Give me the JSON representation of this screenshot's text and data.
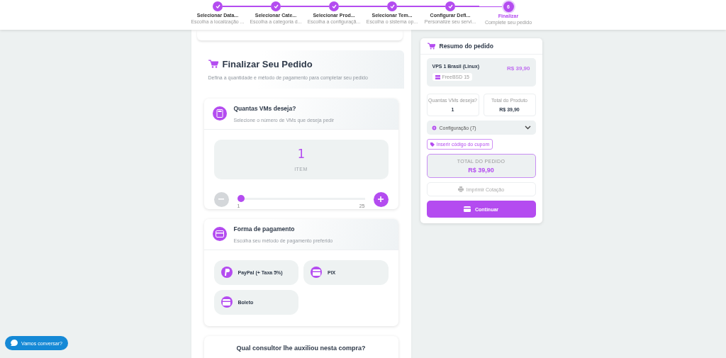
{
  "stepper": [
    {
      "title": "Selecionar Data...",
      "subtitle": "Escolha a localização ...",
      "done": true,
      "selected": false
    },
    {
      "title": "Selecionar Cate...",
      "subtitle": "Escolha a categoria d...",
      "done": true,
      "selected": false
    },
    {
      "title": "Selecionar Prod...",
      "subtitle": "Escolha a configuraçã...",
      "done": true,
      "selected": false
    },
    {
      "title": "Selecionar Tem...",
      "subtitle": "Escolha o sistema op...",
      "done": true,
      "selected": false
    },
    {
      "title": "Configurar Defi...",
      "subtitle": "Personalize seu servi...",
      "done": true,
      "selected": false
    },
    {
      "title": "Finalizar",
      "subtitle": "Complete seu pedido",
      "done": false,
      "selected": true,
      "number": "6"
    }
  ],
  "section": {
    "title": "Finalizar Seu Pedido",
    "subtitle": "Defina a quantidade e método de pagamento para completar seu pedido"
  },
  "quantity_card": {
    "title": "Quantas VMs deseja?",
    "subtitle": "Selecione o número de VMs que deseja pedir",
    "value": "1",
    "unit": "ITEM",
    "slider": {
      "level": 0,
      "min_label": "1",
      "max_label": "25"
    },
    "minus_disabled": true
  },
  "payment_card": {
    "title": "Forma de pagamento",
    "subtitle": "Escolha seu método de pagamento preferido",
    "options": [
      {
        "label": "PayPal (+ Taxa 5%)",
        "kind": "paypal",
        "selected": false
      },
      {
        "label": "PIX",
        "kind": "card",
        "selected": false
      },
      {
        "label": "Boleto",
        "kind": "card",
        "selected": false
      }
    ]
  },
  "consultant_card": {
    "title": "Qual consultor lhe auxiliou nesta compra?"
  },
  "summary": {
    "title": "Resumo do pedido",
    "product": {
      "name": "VPS 1 Brasil (Linux)",
      "price": "R$ 39,90",
      "os_tag": "FreeBSD 15"
    },
    "stats": [
      {
        "label": "Quantas VMs deseja?",
        "value": "1"
      },
      {
        "label": "Total do Produto",
        "value": "R$ 39,90"
      }
    ],
    "config": {
      "label": "Configuração (7)",
      "expanded": false
    },
    "coupon_button": "Inserir código do cupom",
    "total": {
      "label": "TOTAL DO PEDIDO",
      "value": "R$ 39,90"
    },
    "print_button": "Imprimir Cotação",
    "continue_button": "Continuar"
  },
  "chat_button": "Vamos conversar?"
}
